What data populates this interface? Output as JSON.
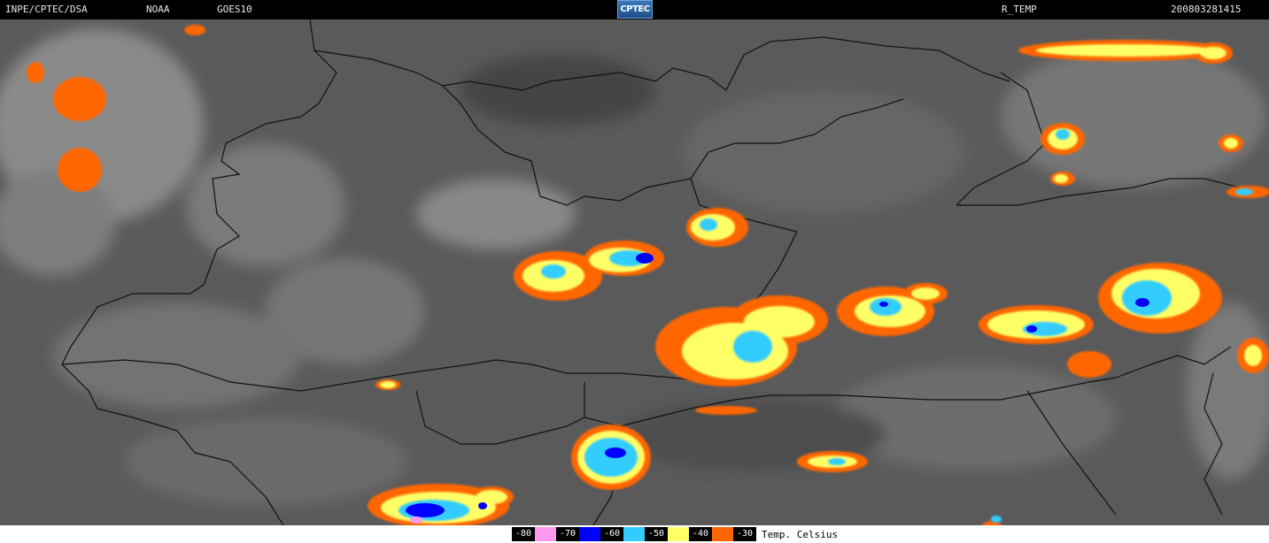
{
  "header": {
    "source": "INPE/CPTEC/DSA",
    "agency": "NOAA",
    "satellite": "GOES10",
    "logo_text": "CPTEC",
    "product": "R_TEMP",
    "timestamp": "200803281415"
  },
  "legend": {
    "unit_label": "Temp. Celsius",
    "items": [
      {
        "label": "-80",
        "color": "#ff99ee"
      },
      {
        "label": "-70",
        "color": "#0000ff"
      },
      {
        "label": "-60",
        "color": "#33ccff"
      },
      {
        "label": "-50",
        "color": "#ffff66"
      },
      {
        "label": "-40",
        "color": "#ff6600"
      },
      {
        "label": "-30",
        "color": "#000000"
      }
    ]
  }
}
